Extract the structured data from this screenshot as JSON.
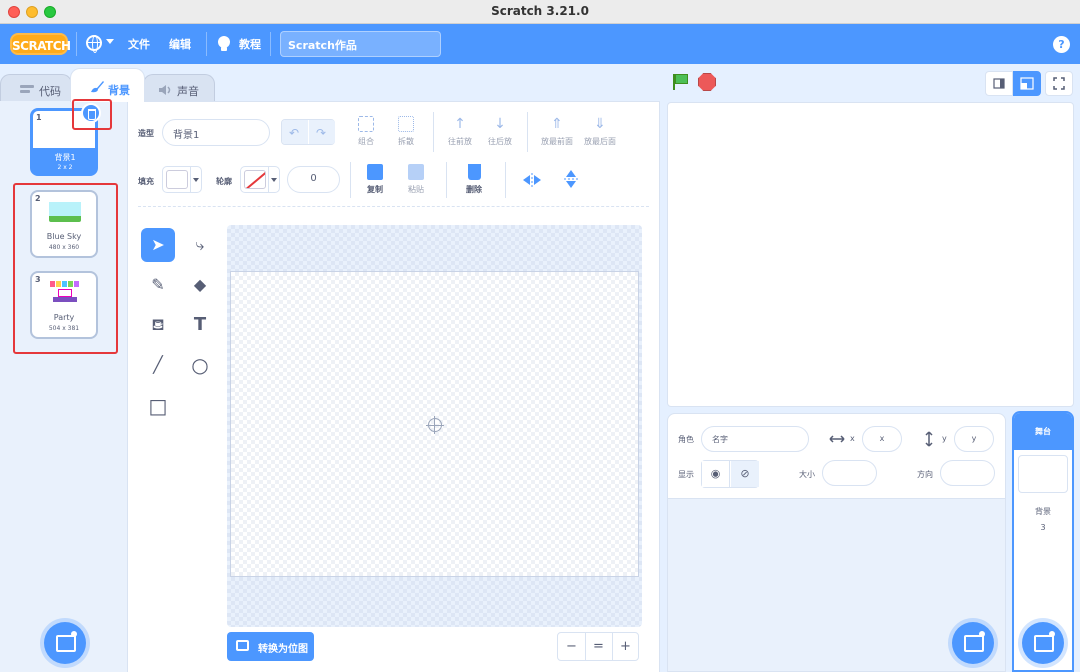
{
  "window": {
    "title": "Scratch 3.21.0"
  },
  "menubar": {
    "logo": "SCRATCH",
    "file": "文件",
    "edit": "编辑",
    "tutorials": "教程",
    "project_title": "Scratch作品",
    "help": "?"
  },
  "tabs": {
    "code": "代码",
    "backdrops": "背景",
    "sounds": "声音"
  },
  "backdrops": [
    {
      "num": "1",
      "name": "背景1",
      "size": "2 x 2"
    },
    {
      "num": "2",
      "name": "Blue Sky",
      "size": "480 x 360"
    },
    {
      "num": "3",
      "name": "Party",
      "size": "504 x 381"
    }
  ],
  "paint": {
    "costume_label": "造型",
    "costume_name": "背景1",
    "group": "组合",
    "ungroup": "拆散",
    "forward": "往前放",
    "backward": "往后放",
    "front": "放最前面",
    "back": "放最后面",
    "fill_label": "填充",
    "outline_label": "轮廓",
    "outline_width": "0",
    "copy": "复制",
    "paste": "粘贴",
    "delete": "删除",
    "convert_bitmap": "转换为位图",
    "zoom_out": "−",
    "zoom_reset": "=",
    "zoom_in": "+"
  },
  "sprite_info": {
    "sprite_label": "角色",
    "name_placeholder": "名字",
    "x_label": "x",
    "x_placeholder": "x",
    "y_label": "y",
    "y_placeholder": "y",
    "show_label": "显示",
    "size_label": "大小",
    "direction_label": "方向"
  },
  "stage_selector": {
    "header": "舞台",
    "backdrops_label": "背景",
    "backdrops_count": "3"
  },
  "colors": {
    "accent": "#4c97ff",
    "highlight": "#e5383b",
    "logo": "#ffab19"
  }
}
